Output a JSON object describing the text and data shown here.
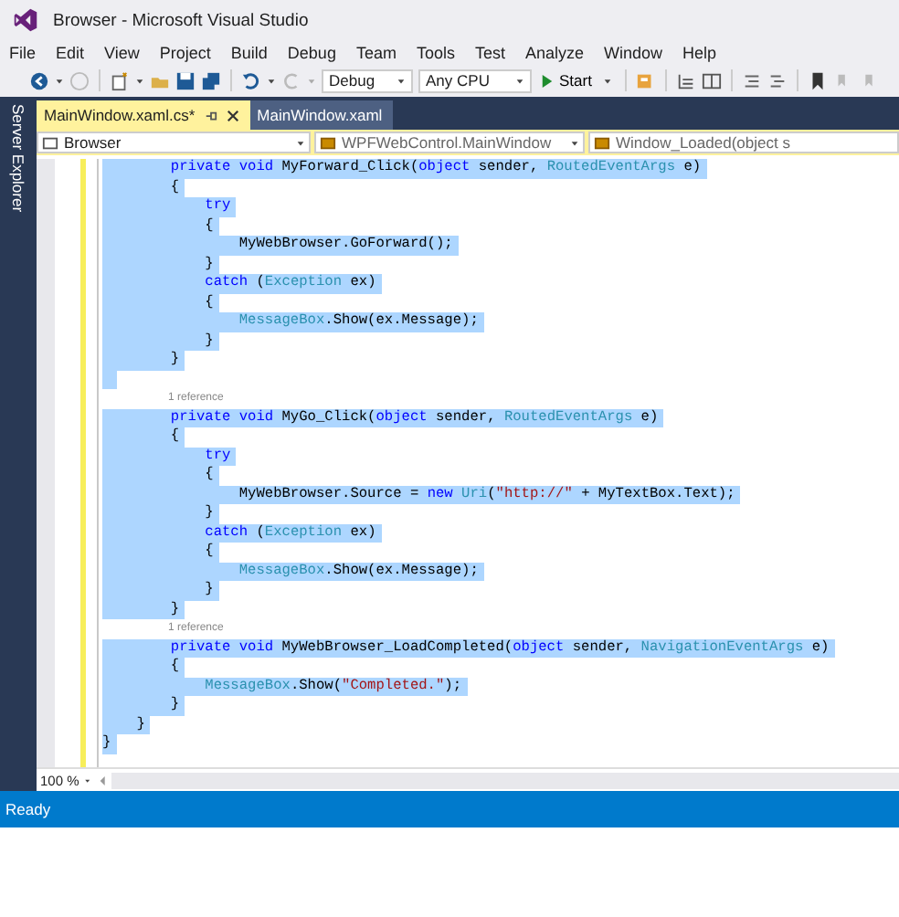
{
  "window": {
    "title": "Browser - Microsoft Visual Studio"
  },
  "menu": [
    "File",
    "Edit",
    "View",
    "Project",
    "Build",
    "Debug",
    "Team",
    "Tools",
    "Test",
    "Analyze",
    "Window",
    "Help"
  ],
  "toolbar": {
    "configuration": "Debug",
    "platform": "Any CPU",
    "start": "Start"
  },
  "side_tab": "Server Explorer",
  "tabs": [
    {
      "label": "MainWindow.xaml.cs*",
      "selected": true
    },
    {
      "label": "MainWindow.xaml",
      "selected": false
    }
  ],
  "nav_bar": [
    "Browser",
    "WPFWebControl.MainWindow",
    "Window_Loaded(object s"
  ],
  "lines": [
    {
      "kind": "code",
      "selected": true,
      "tokens": [
        {
          "text": "        private void",
          "kind": "keyword"
        },
        {
          "text": " MyForward_Click(",
          "kind": "plain"
        },
        {
          "text": "object",
          "kind": "keyword"
        },
        {
          "text": " sender, ",
          "kind": "plain"
        },
        {
          "text": "RoutedEventArgs",
          "kind": "type"
        },
        {
          "text": " e)",
          "kind": "plain"
        }
      ]
    },
    {
      "kind": "code",
      "selected": true,
      "tokens": [
        {
          "text": "        {",
          "kind": "plain"
        }
      ]
    },
    {
      "kind": "code",
      "selected": true,
      "tokens": [
        {
          "text": "            try",
          "kind": "keyword"
        }
      ]
    },
    {
      "kind": "code",
      "selected": true,
      "tokens": [
        {
          "text": "            {",
          "kind": "plain"
        }
      ]
    },
    {
      "kind": "code",
      "selected": true,
      "tokens": [
        {
          "text": "                MyWebBrowser.GoForward();",
          "kind": "plain"
        }
      ]
    },
    {
      "kind": "code",
      "selected": true,
      "tokens": [
        {
          "text": "            }",
          "kind": "plain"
        }
      ]
    },
    {
      "kind": "code",
      "selected": true,
      "tokens": [
        {
          "text": "            catch",
          "kind": "keyword"
        },
        {
          "text": " (",
          "kind": "plain"
        },
        {
          "text": "Exception",
          "kind": "type"
        },
        {
          "text": " ex)",
          "kind": "plain"
        }
      ]
    },
    {
      "kind": "code",
      "selected": true,
      "tokens": [
        {
          "text": "            {",
          "kind": "plain"
        }
      ]
    },
    {
      "kind": "code",
      "selected": true,
      "tokens": [
        {
          "text": "                MessageBox",
          "kind": "type"
        },
        {
          "text": ".Show(ex.Message);",
          "kind": "plain"
        }
      ]
    },
    {
      "kind": "code",
      "selected": true,
      "tokens": [
        {
          "text": "            }",
          "kind": "plain"
        }
      ]
    },
    {
      "kind": "code",
      "selected": true,
      "tokens": [
        {
          "text": "        }",
          "kind": "plain"
        }
      ]
    },
    {
      "kind": "code",
      "selected": true
    },
    {
      "kind": "codelens",
      "text": "1 reference"
    },
    {
      "kind": "code",
      "selected": true,
      "tokens": [
        {
          "text": "        private void",
          "kind": "keyword"
        },
        {
          "text": " MyGo_Click(",
          "kind": "plain"
        },
        {
          "text": "object",
          "kind": "keyword"
        },
        {
          "text": " sender, ",
          "kind": "plain"
        },
        {
          "text": "RoutedEventArgs",
          "kind": "type"
        },
        {
          "text": " e)",
          "kind": "plain"
        }
      ]
    },
    {
      "kind": "code",
      "selected": true,
      "tokens": [
        {
          "text": "        {",
          "kind": "plain"
        }
      ]
    },
    {
      "kind": "code",
      "selected": true,
      "tokens": [
        {
          "text": "            try",
          "kind": "keyword"
        }
      ]
    },
    {
      "kind": "code",
      "selected": true,
      "tokens": [
        {
          "text": "            {",
          "kind": "plain"
        }
      ]
    },
    {
      "kind": "code",
      "selected": true,
      "tokens": [
        {
          "text": "                MyWebBrowser.Source = ",
          "kind": "plain"
        },
        {
          "text": "new",
          "kind": "keyword"
        },
        {
          "text": " Uri",
          "kind": "type"
        },
        {
          "text": "(",
          "kind": "plain"
        },
        {
          "text": "\"http://\"",
          "kind": "string"
        },
        {
          "text": " + MyTextBox.Text);",
          "kind": "plain"
        }
      ]
    },
    {
      "kind": "code",
      "selected": true,
      "tokens": [
        {
          "text": "            }",
          "kind": "plain"
        }
      ]
    },
    {
      "kind": "code",
      "selected": true,
      "tokens": [
        {
          "text": "            catch",
          "kind": "keyword"
        },
        {
          "text": " (",
          "kind": "plain"
        },
        {
          "text": "Exception",
          "kind": "type"
        },
        {
          "text": " ex)",
          "kind": "plain"
        }
      ]
    },
    {
      "kind": "code",
      "selected": true,
      "tokens": [
        {
          "text": "            {",
          "kind": "plain"
        }
      ]
    },
    {
      "kind": "code",
      "selected": true,
      "tokens": [
        {
          "text": "                MessageBox",
          "kind": "type"
        },
        {
          "text": ".Show(ex.Message);",
          "kind": "plain"
        }
      ]
    },
    {
      "kind": "code",
      "selected": true,
      "tokens": [
        {
          "text": "            }",
          "kind": "plain"
        }
      ]
    },
    {
      "kind": "code",
      "selected": true,
      "tokens": [
        {
          "text": "        }",
          "kind": "plain"
        }
      ]
    },
    {
      "kind": "codelens",
      "text": "1 reference"
    },
    {
      "kind": "code",
      "selected": true,
      "tokens": [
        {
          "text": "        private void",
          "kind": "keyword"
        },
        {
          "text": " MyWebBrowser_LoadCompleted(",
          "kind": "plain"
        },
        {
          "text": "object",
          "kind": "keyword"
        },
        {
          "text": " sender, ",
          "kind": "plain"
        },
        {
          "text": "NavigationEventArgs",
          "kind": "type"
        },
        {
          "text": " e)",
          "kind": "plain"
        }
      ]
    },
    {
      "kind": "code",
      "selected": true,
      "tokens": [
        {
          "text": "        {",
          "kind": "plain"
        }
      ]
    },
    {
      "kind": "code",
      "selected": true,
      "tokens": [
        {
          "text": "            MessageBox",
          "kind": "type"
        },
        {
          "text": ".Show(",
          "kind": "plain"
        },
        {
          "text": "\"Completed.\"",
          "kind": "string"
        },
        {
          "text": ");",
          "kind": "plain"
        }
      ]
    },
    {
      "kind": "code",
      "selected": true,
      "tokens": [
        {
          "text": "        }",
          "kind": "plain"
        }
      ]
    },
    {
      "kind": "code",
      "selected": true,
      "tokens": [
        {
          "text": "    }",
          "kind": "plain"
        }
      ]
    },
    {
      "kind": "code",
      "selected": true,
      "tokens": [
        {
          "text": "}",
          "kind": "plain"
        }
      ]
    }
  ],
  "zoom": "100 %",
  "status_bar": "Ready"
}
